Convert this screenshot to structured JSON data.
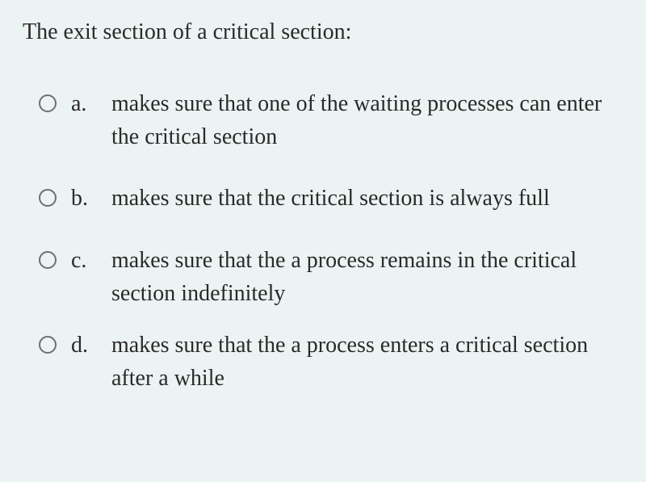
{
  "question": "The exit section of a critical section:",
  "options": [
    {
      "letter": "a.",
      "text": "makes sure that one of the waiting processes can enter the critical section"
    },
    {
      "letter": "b.",
      "text": "makes sure that the critical section is always full"
    },
    {
      "letter": "c.",
      "text": "makes sure that the a process remains in the critical section indefinitely"
    },
    {
      "letter": "d.",
      "text": "makes sure that the a process enters a critical section after a while"
    }
  ]
}
